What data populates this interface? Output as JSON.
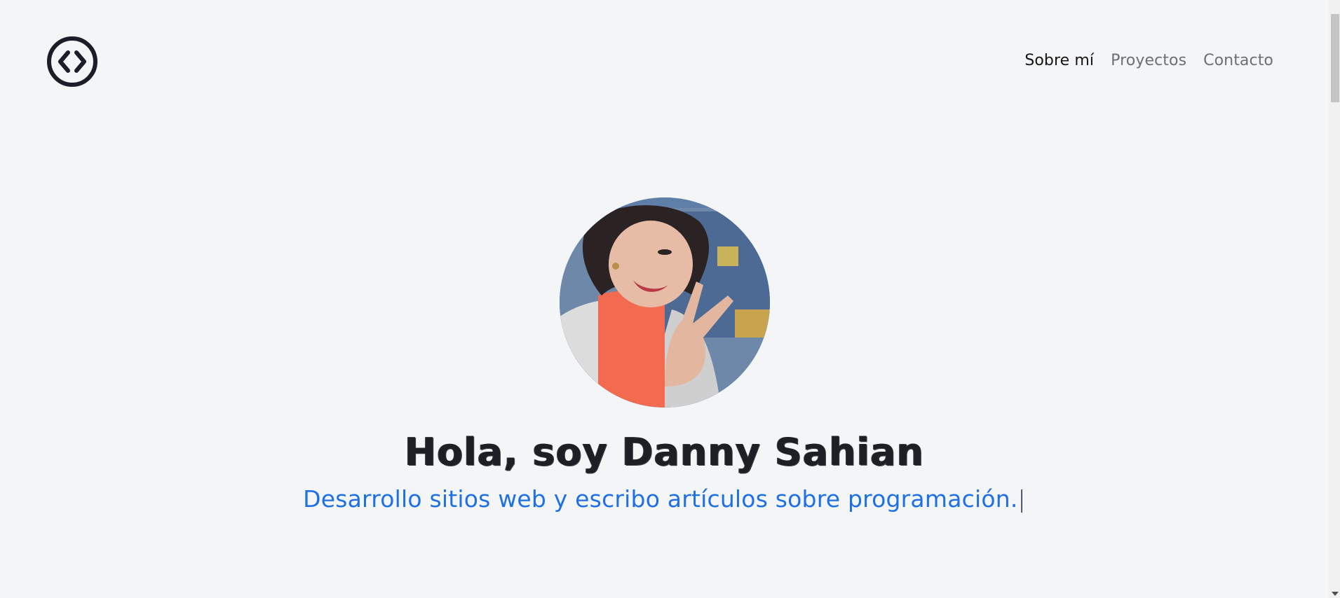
{
  "header": {
    "logo_icon": "code-brackets-circle-icon",
    "nav": [
      {
        "label": "Sobre mí",
        "active": true
      },
      {
        "label": "Proyectos",
        "active": false
      },
      {
        "label": "Contacto",
        "active": false
      }
    ]
  },
  "hero": {
    "avatar_icon": "profile-photo",
    "title": "Hola, soy Danny Sahian",
    "subtitle": "Desarrollo sitios web y escribo artículos sobre programación.",
    "cursor": "|"
  },
  "colors": {
    "background": "#f4f5f7",
    "title": "#1d1f24",
    "subtitle": "#1f6fe5",
    "nav_active": "#141414",
    "nav_inactive": "#6b6f76"
  }
}
